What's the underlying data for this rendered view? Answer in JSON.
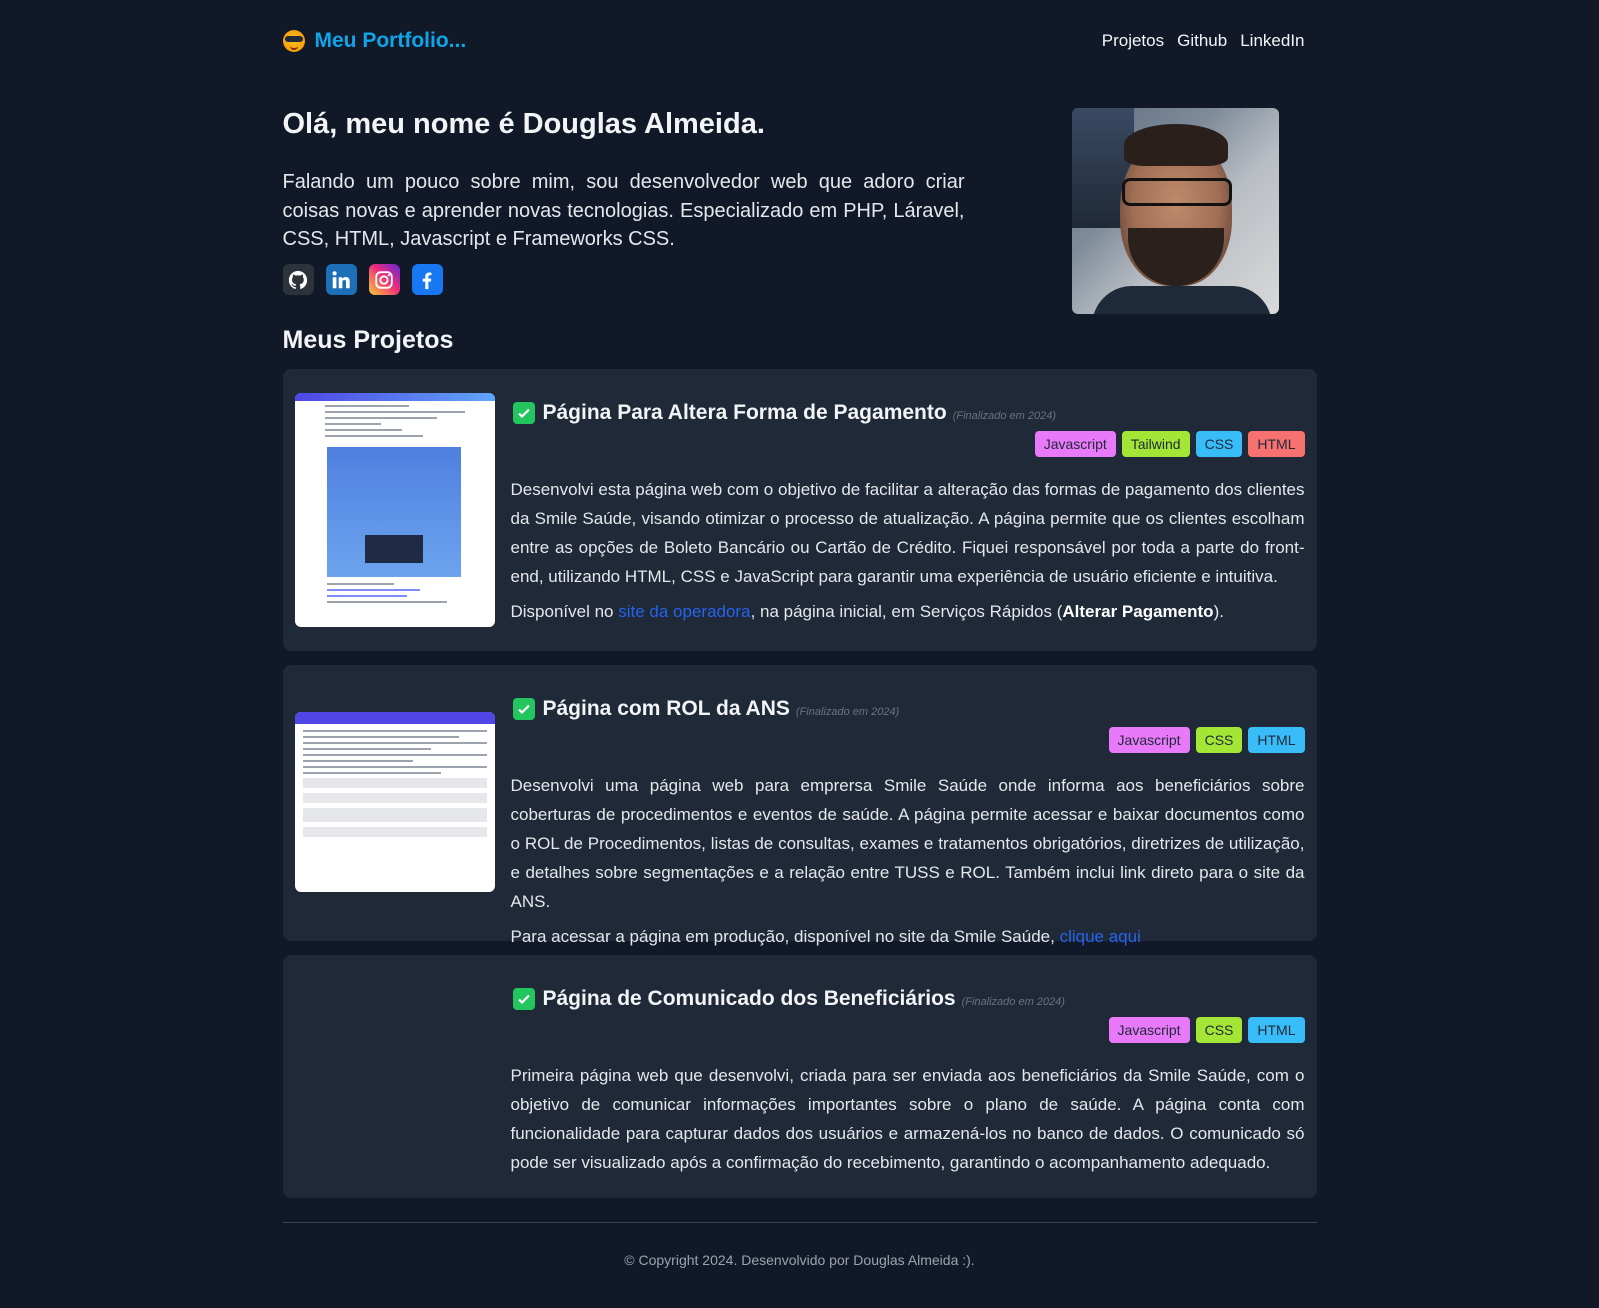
{
  "header": {
    "brand": "Meu Portfolio...",
    "nav": [
      "Projetos",
      "Github",
      "LinkedIn"
    ]
  },
  "hero": {
    "title": "Olá, meu nome é Douglas Almeida.",
    "about": "Falando um pouco sobre mim, sou desenvolvedor web que adoro criar coisas novas e aprender novas tecnologias. Especializado em PHP, Láravel, CSS, HTML, Javascript e Frameworks CSS.",
    "socials": [
      "github-icon",
      "linkedin-icon",
      "instagram-icon",
      "facebook-icon"
    ]
  },
  "projects_heading": "Meus Projetos",
  "projects": [
    {
      "title": "Página Para Altera Forma de Pagamento",
      "status": "(Finalizado em 2024)",
      "badges": [
        "Javascript",
        "Tailwind",
        "CSS",
        "HTML"
      ],
      "description": "Desenvolvi esta página web com o objetivo de facilitar a alteração das formas de pagamento dos clientes da Smile Saúde, visando otimizar o processo de atualização. A página permite que os clientes escolham entre as opções de Boleto Bancário ou Cartão de Crédito. Fiquei responsável por toda a parte do front-end, utilizando HTML, CSS e JavaScript para garantir uma experiência de usuário eficiente e intuitiva.",
      "extra_prefix": "Disponível no ",
      "extra_link": "site da operadora",
      "extra_middle": ", na página inicial, em Serviços Rápidos (",
      "extra_bold": "Alterar Pagamento",
      "extra_suffix": ")."
    },
    {
      "title": "Página com ROL da ANS",
      "status": "(Finalizado em 2024)",
      "badges": [
        "Javascript",
        "CSS",
        "HTML"
      ],
      "description": "Desenvolvi uma página web para emprersa Smile Saúde onde informa aos beneficiários sobre coberturas de procedimentos e eventos de saúde. A página permite acessar e baixar documentos como o ROL de Procedimentos, listas de consultas, exames e tratamentos obrigatórios, diretrizes de utilização, e detalhes sobre segmentações e a relação entre TUSS e ROL. Também inclui link direto para o site da ANS.",
      "extra_prefix": "Para acessar a página em produção, disponível no site da Smile Saúde, ",
      "extra_link": "clique aqui"
    },
    {
      "title": "Página de Comunicado dos Beneficiários",
      "status": "(Finalizado em 2024)",
      "badges": [
        "Javascript",
        "CSS",
        "HTML"
      ],
      "description": "Primeira página web que desenvolvi, criada para ser enviada aos beneficiários da Smile Saúde, com o objetivo de comunicar informações importantes sobre o plano de saúde. A página conta com funcionalidade para capturar dados dos usuários e armazená-los no banco de dados. O comunicado só pode ser visualizado após a confirmação do recebimento, garantindo o acompanhamento adequado."
    }
  ],
  "footer": "© Copyright 2024. Desenvolvido por Douglas Almeida :)."
}
